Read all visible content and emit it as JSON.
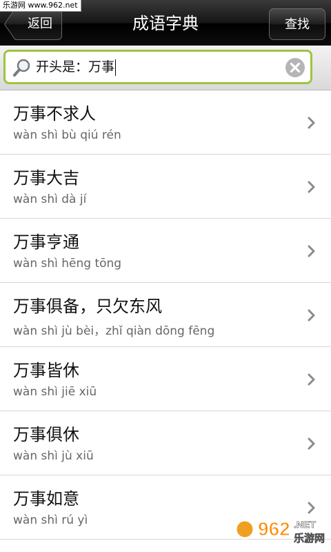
{
  "watermark_top": "乐游网 www.962.net",
  "header": {
    "back_label": "返回",
    "title": "成语字典",
    "search_label": "查找"
  },
  "search": {
    "value": "开头是：万事"
  },
  "items": [
    {
      "idiom": "万事不求人",
      "pinyin": "wàn  shì  bù  qiú  rén"
    },
    {
      "idiom": "万事大吉",
      "pinyin": "wàn shì dà jí"
    },
    {
      "idiom": "万事亨通",
      "pinyin": "wàn shì hēng tōng"
    },
    {
      "idiom": "万事俱备，只欠东风",
      "pinyin": "wàn shì jù bèi，zhǐ qiàn dōng fēng"
    },
    {
      "idiom": "万事皆休",
      "pinyin": "wàn  shì  jiē  xiū"
    },
    {
      "idiom": "万事俱休",
      "pinyin": "wàn  shì  jù  xiū"
    },
    {
      "idiom": "万事如意",
      "pinyin": "wàn  shì  rú  yì"
    }
  ],
  "watermark_bottom": {
    "logo": "962",
    "domain": ".NET",
    "name": "乐游网"
  },
  "colors": {
    "search_border": "#9cc53d",
    "titlebar": "#111111"
  },
  "icons": {
    "search": "magnifier-icon",
    "clear": "clear-icon",
    "row": "chevron-right-icon"
  }
}
